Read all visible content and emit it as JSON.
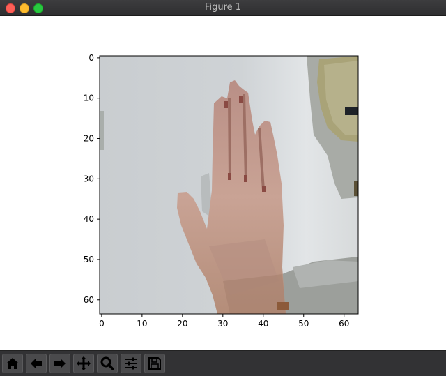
{
  "window": {
    "title": "Figure 1"
  },
  "toolbar": {
    "buttons": [
      {
        "icon": "home-icon"
      },
      {
        "icon": "back-arrow-icon"
      },
      {
        "icon": "forward-arrow-icon"
      },
      {
        "icon": "pan-move-icon"
      },
      {
        "icon": "zoom-magnifier-icon"
      },
      {
        "icon": "configure-subplots-icon"
      },
      {
        "icon": "save-floppy-icon"
      }
    ]
  },
  "chart_data": {
    "type": "image",
    "xticks": [
      "0",
      "10",
      "20",
      "30",
      "40",
      "50",
      "60"
    ],
    "yticks": [
      "0",
      "10",
      "20",
      "30",
      "40",
      "50",
      "60"
    ],
    "xlim": [
      -0.5,
      63.5
    ],
    "ylim": [
      63.5,
      -0.5
    ],
    "image_size": [
      64,
      64
    ]
  }
}
